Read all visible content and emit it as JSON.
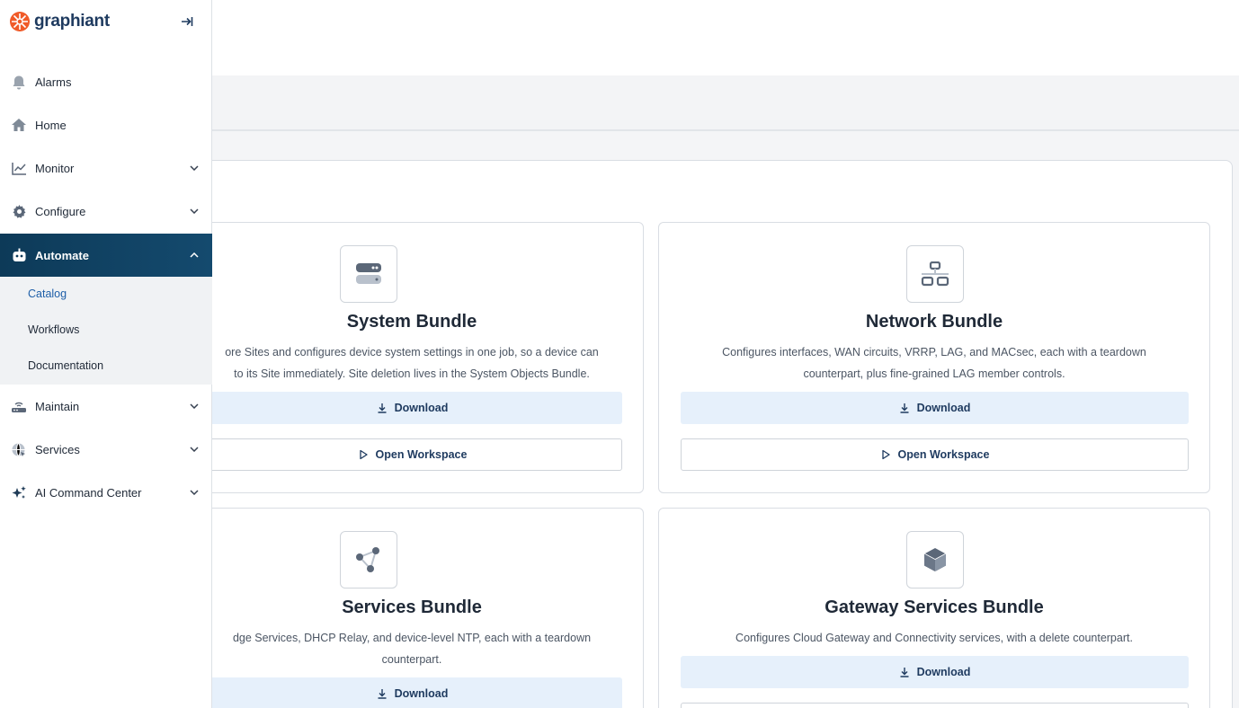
{
  "app": {
    "logo_text": "graphiant"
  },
  "sidebar": {
    "items": [
      {
        "label": "Alarms"
      },
      {
        "label": "Home"
      },
      {
        "label": "Monitor"
      },
      {
        "label": "Configure"
      },
      {
        "label": "Automate"
      },
      {
        "label": "Maintain"
      },
      {
        "label": "Services"
      },
      {
        "label": "AI Command Center"
      }
    ],
    "automate_sub": [
      {
        "label": "Catalog"
      },
      {
        "label": "Workflows"
      },
      {
        "label": "Documentation"
      }
    ],
    "active_item": "Automate",
    "active_sub": "Catalog"
  },
  "cards": [
    {
      "title": "System Bundle",
      "desc_line1": "ore Sites and configures device system settings in one job, so a device can",
      "desc_line2": "to its Site immediately. Site deletion lives in the System Objects Bundle.",
      "download_label": "Download",
      "open_label": "Open Workspace",
      "icon": "server-icon"
    },
    {
      "title": "Network Bundle",
      "desc_line1": "Configures interfaces, WAN circuits, VRRP, LAG, and MACsec, each with a teardown",
      "desc_line2": "counterpart, plus fine-grained LAG member controls.",
      "download_label": "Download",
      "open_label": "Open Workspace",
      "icon": "network-icon"
    },
    {
      "title": "Services Bundle",
      "desc_line1": "dge Services, DHCP Relay, and device-level NTP, each with a teardown",
      "desc_line2": "counterpart.",
      "download_label": "Download",
      "icon": "share-nodes-icon"
    },
    {
      "title": "Gateway Services Bundle",
      "desc_line1": "Configures Cloud Gateway and Connectivity services, with a delete counterpart.",
      "download_label": "Download",
      "icon": "cube-icon"
    }
  ],
  "colors": {
    "accent": "#0d3a58",
    "download_bg": "#e6f0fb",
    "link": "#1e5fa8"
  }
}
